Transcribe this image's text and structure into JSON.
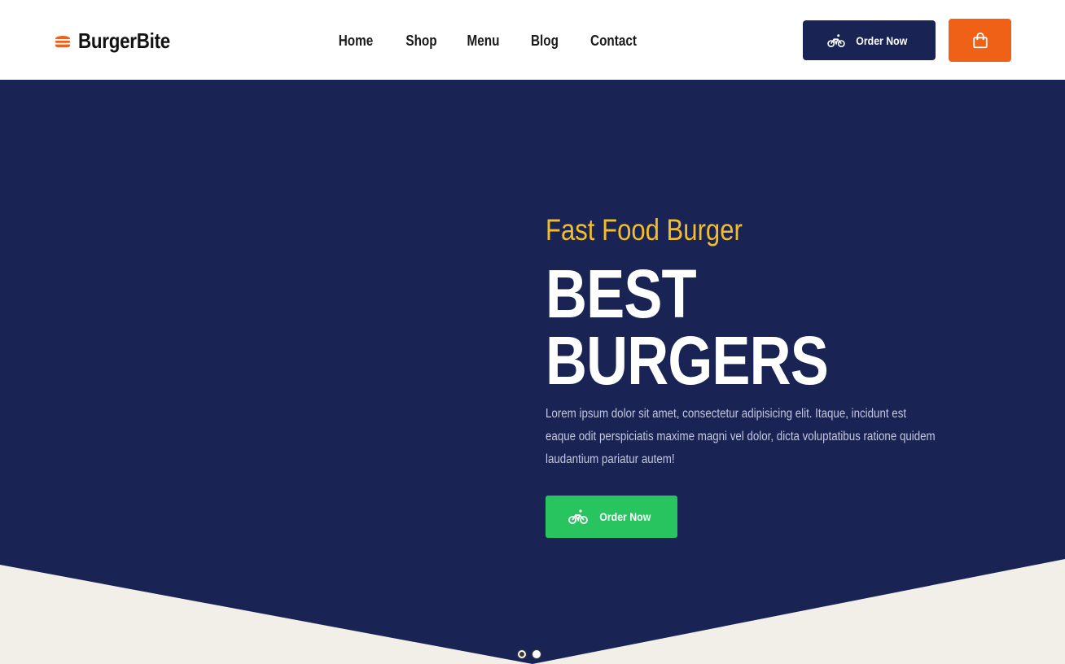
{
  "brand": {
    "name": "BurgerBite",
    "icon": "burger-icon"
  },
  "nav": {
    "items": [
      {
        "label": "Home"
      },
      {
        "label": "Shop"
      },
      {
        "label": "Menu"
      },
      {
        "label": "Blog"
      },
      {
        "label": "Contact"
      }
    ]
  },
  "header": {
    "order_button": {
      "label": "Order Now",
      "icon": "bicycle-icon"
    },
    "cart_button": {
      "icon": "shopping-bag-icon"
    }
  },
  "hero": {
    "subtitle": "Fast Food Burger",
    "title_line1": "BEST",
    "title_line2": "BURGERS",
    "description": "Lorem ipsum dolor sit amet, consectetur adipisicing elit. Itaque, incidunt est eaque odit perspiciatis maxime magni vel dolor, dicta voluptatibus ratione quidem laudantium pariatur autem!",
    "order_button": {
      "label": "Order Now",
      "icon": "bicycle-icon"
    },
    "slider": {
      "slide_count": 2,
      "active_slide": 1
    }
  },
  "colors": {
    "navy": "#192455",
    "orange": "#ee6116",
    "green": "#27c45f",
    "yellow": "#f2bd2a",
    "cream": "#f2efe9"
  }
}
